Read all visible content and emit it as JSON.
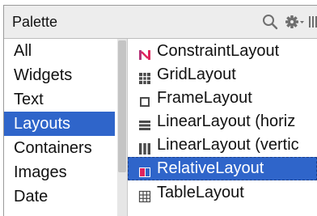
{
  "palette": {
    "title": "Palette",
    "icons": [
      "search-icon",
      "gear-icon",
      "layout-mode-icon"
    ]
  },
  "categories": [
    {
      "label": "All"
    },
    {
      "label": "Widgets"
    },
    {
      "label": "Text"
    },
    {
      "label": "Layouts",
      "selected": true
    },
    {
      "label": "Containers"
    },
    {
      "label": "Images"
    },
    {
      "label": "Date"
    }
  ],
  "items": [
    {
      "label": "ConstraintLayout",
      "icon": "constraint-layout-icon"
    },
    {
      "label": "GridLayout",
      "icon": "grid-layout-icon"
    },
    {
      "label": "FrameLayout",
      "icon": "frame-layout-icon"
    },
    {
      "label": "LinearLayout (horiz",
      "icon": "linear-layout-horizontal-icon"
    },
    {
      "label": "LinearLayout (vertic",
      "icon": "linear-layout-vertical-icon"
    },
    {
      "label": "RelativeLayout",
      "icon": "relative-layout-icon",
      "selected": true
    },
    {
      "label": "TableLayout",
      "icon": "table-layout-icon"
    }
  ],
  "colors": {
    "selection": "#2f65ca",
    "header_bg": "#ededed",
    "constraint_icon": "#e0245e"
  }
}
